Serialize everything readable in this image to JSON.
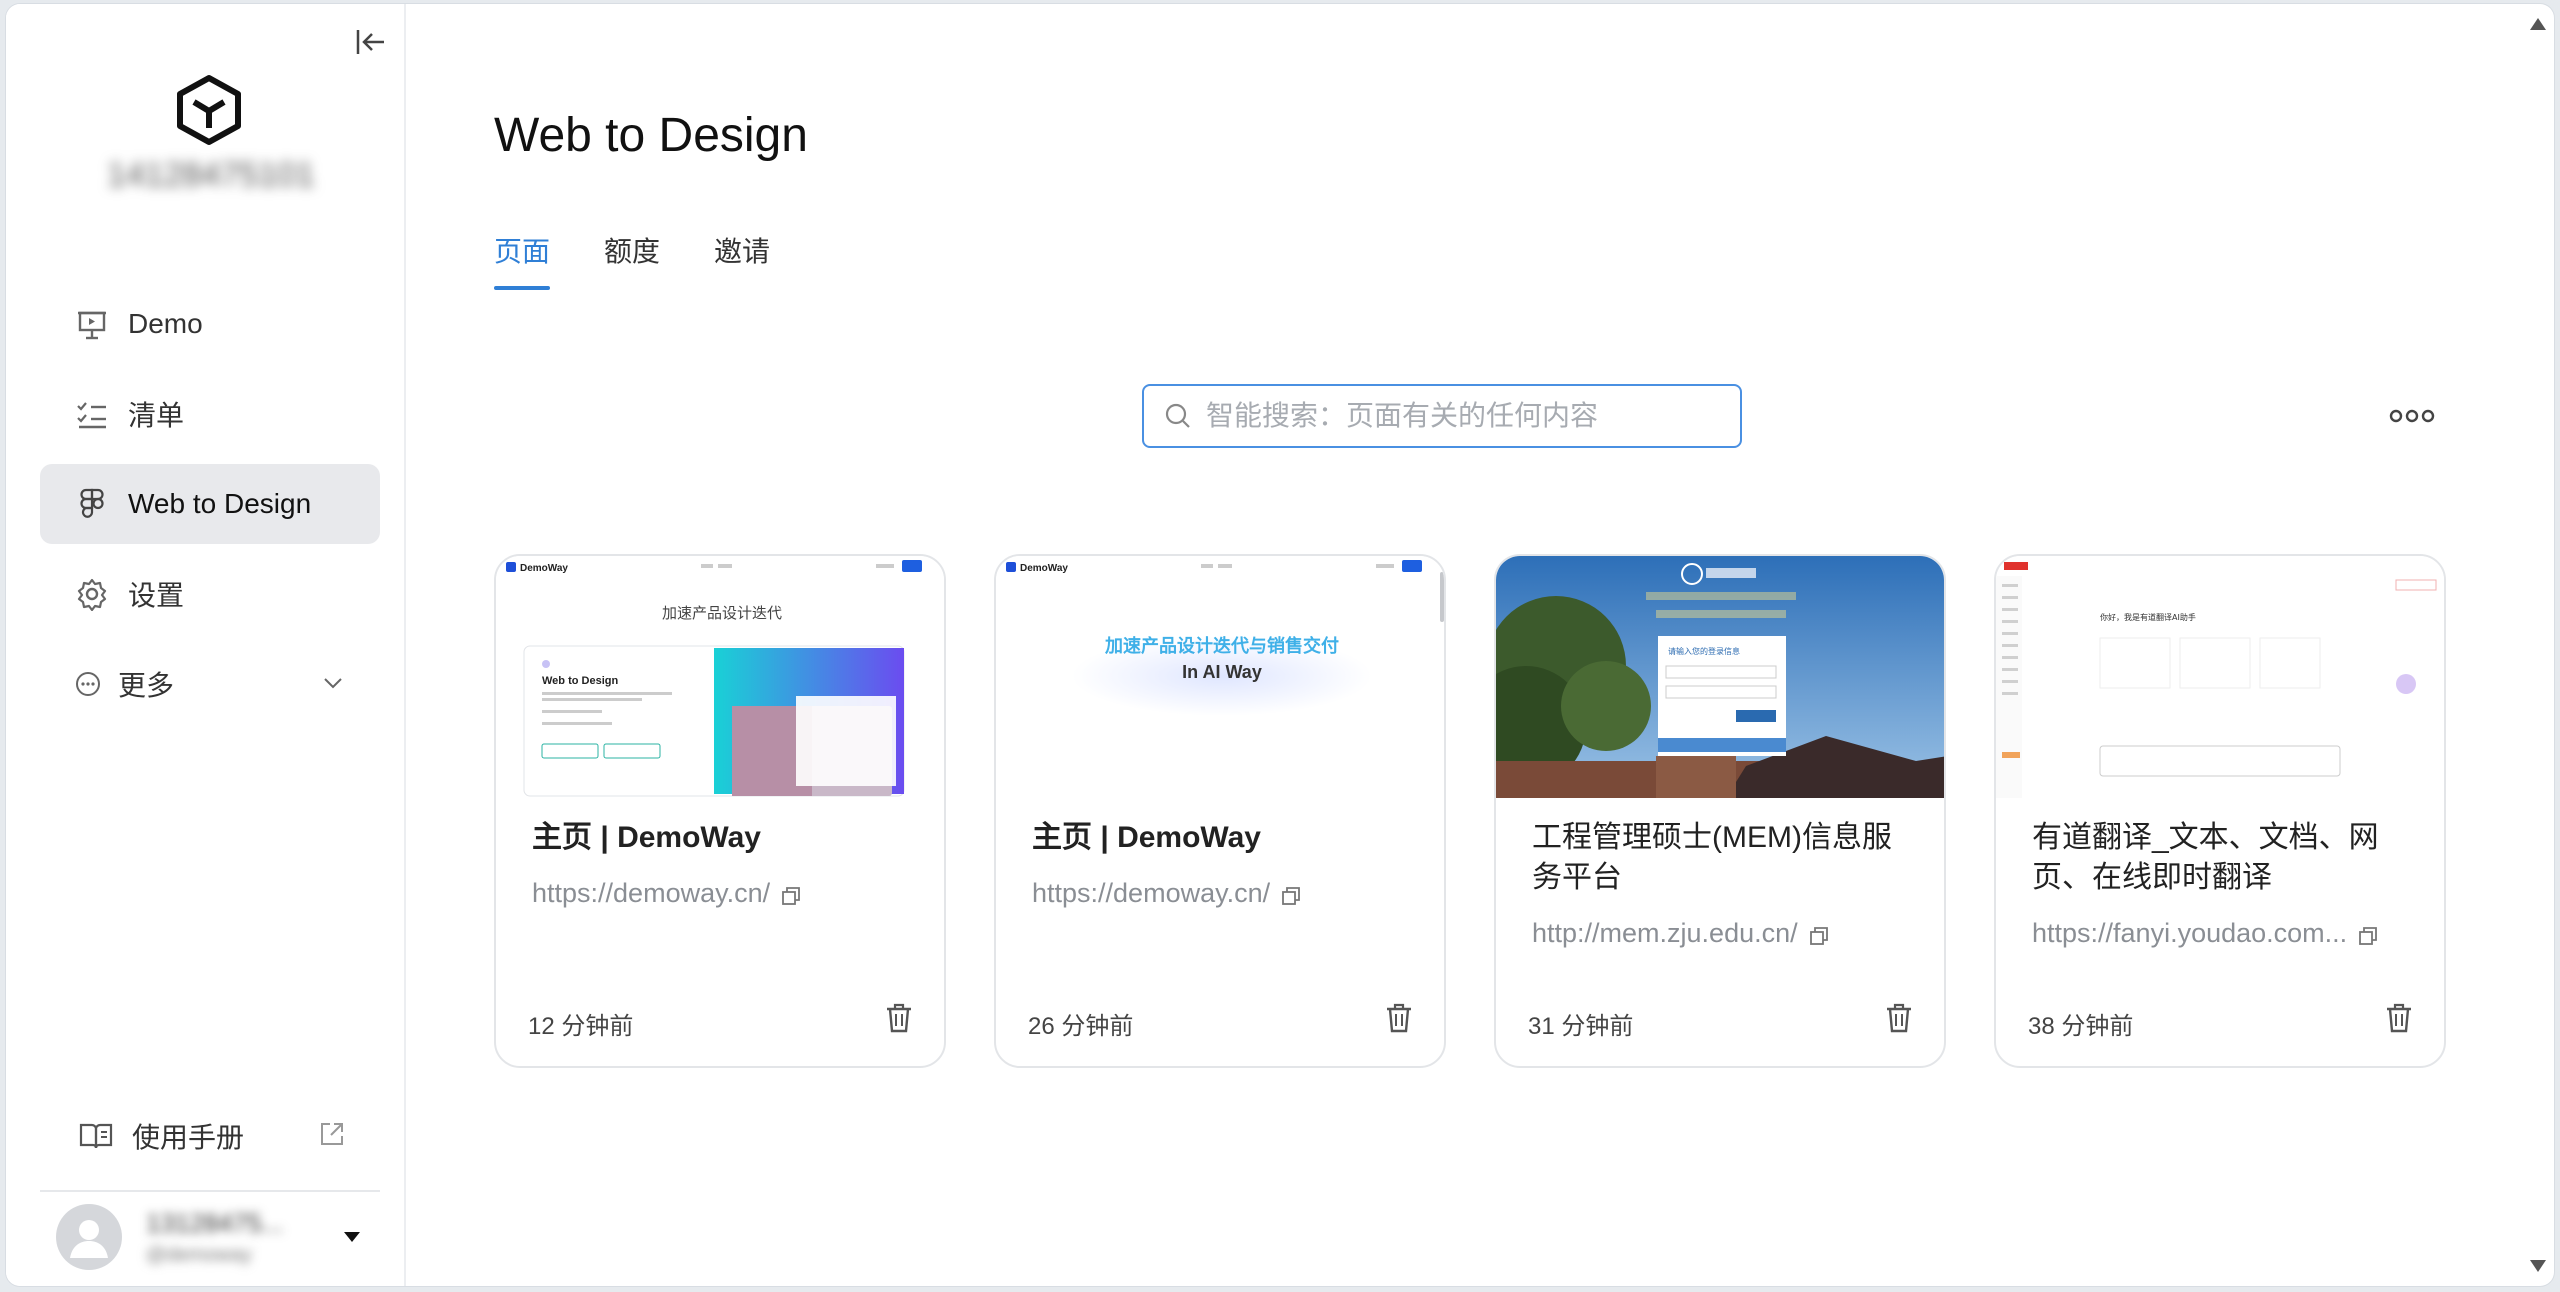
{
  "sidebar": {
    "account_id": "14128475101",
    "items": [
      {
        "label": "Demo"
      },
      {
        "label": "清单"
      },
      {
        "label": "Web to Design"
      },
      {
        "label": "设置"
      },
      {
        "label": "更多"
      }
    ],
    "manual_label": "使用手册",
    "user": {
      "name": "13128475...",
      "sub": "@demoway"
    }
  },
  "main": {
    "title": "Web to Design",
    "tabs": [
      {
        "label": "页面"
      },
      {
        "label": "额度"
      },
      {
        "label": "邀请"
      }
    ],
    "search": {
      "placeholder": "智能搜索：页面有关的任何内容",
      "value": ""
    },
    "cards": [
      {
        "title": "主页 | DemoWay",
        "url": "https://demoway.cn/",
        "time": "12 分钟前",
        "thumb": {
          "brand": "DemoWay",
          "headline": "加速产品设计迭代",
          "panel_title": "Web to Design"
        }
      },
      {
        "title": "主页 | DemoWay",
        "url": "https://demoway.cn/",
        "time": "26 分钟前",
        "thumb": {
          "brand": "DemoWay",
          "headline": "加速产品设计迭代与销售交付",
          "sub": "In AI Way"
        }
      },
      {
        "title": "工程管理硕士(MEM)信息服务平台",
        "url": "http://mem.zju.edu.cn/",
        "time": "31 分钟前",
        "thumb": {
          "login_label": "请输入您的登录信息"
        }
      },
      {
        "title": "有道翻译_文本、文档、网页、在线即时翻译",
        "url": "https://fanyi.youdao.com...",
        "time": "38 分钟前",
        "thumb": {
          "greeting": "你好，我是有道翻译AI助手"
        }
      }
    ]
  },
  "colors": {
    "accent": "#2f7fd6",
    "active_bg": "#e8e9ec"
  }
}
